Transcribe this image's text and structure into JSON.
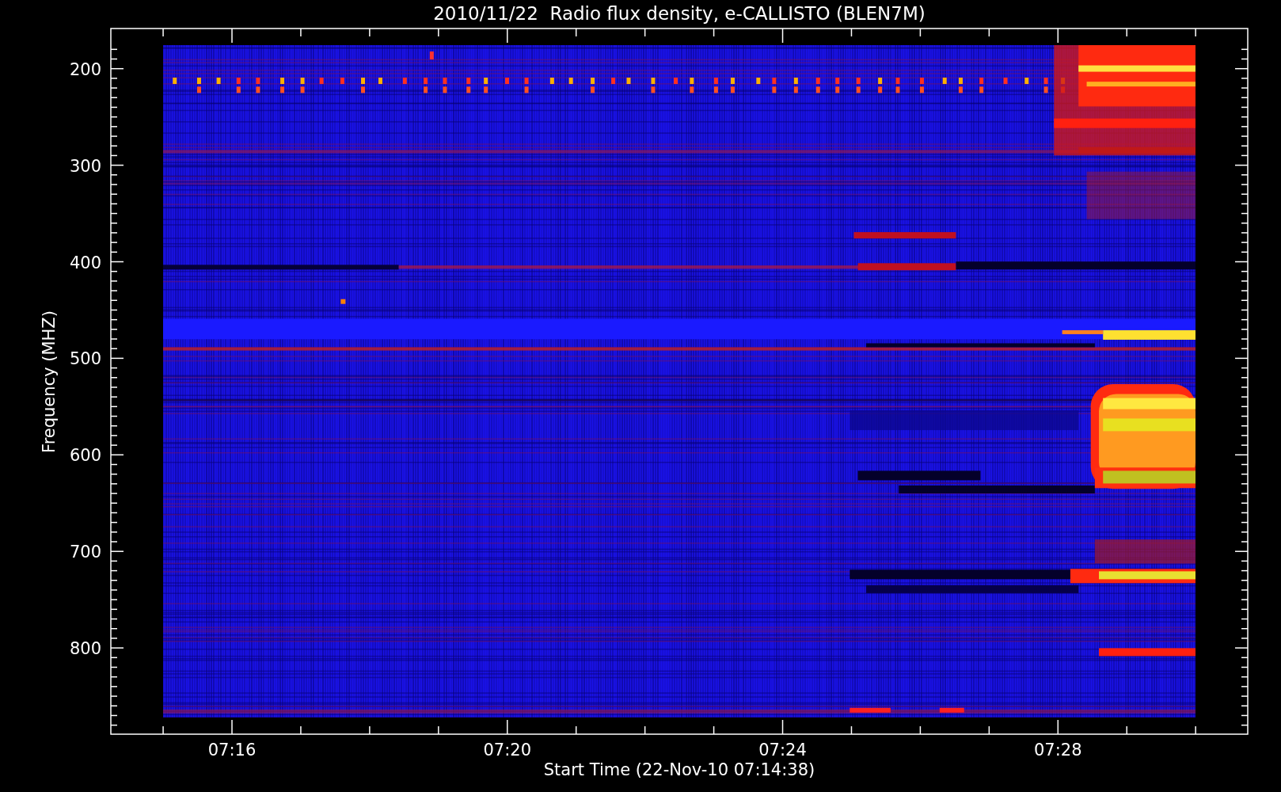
{
  "title": "2010/11/22  Radio flux density, e-CALLISTO (BLEN7M)",
  "y_axis": {
    "label": "Frequency (MHZ)",
    "tick_labels": [
      "200",
      "300",
      "400",
      "500",
      "600",
      "700",
      "800"
    ]
  },
  "x_axis": {
    "label": "Start Time (22-Nov-10 07:14:38)",
    "tick_labels": [
      "07:16",
      "07:20",
      "07:24",
      "07:28"
    ]
  }
}
